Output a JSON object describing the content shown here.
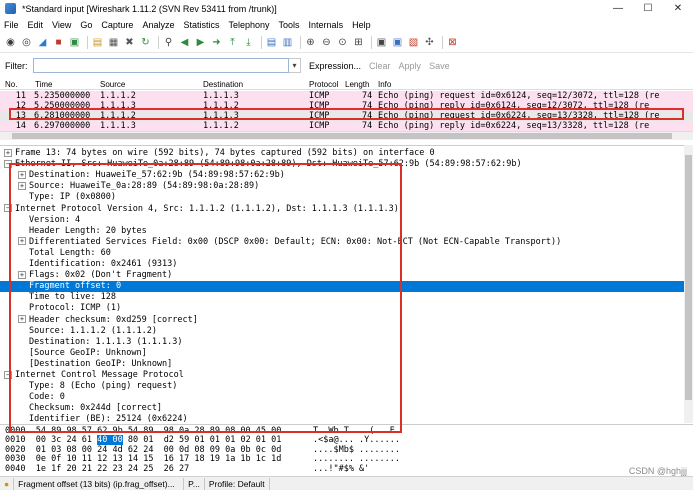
{
  "window": {
    "title": "*Standard input [Wireshark 1.11.2 (SVN Rev 53411 from /trunk)]",
    "minimize": "—",
    "maximize": "☐",
    "close": "✕"
  },
  "menu": [
    "File",
    "Edit",
    "View",
    "Go",
    "Capture",
    "Analyze",
    "Statistics",
    "Telephony",
    "Tools",
    "Internals",
    "Help"
  ],
  "toolbar": {
    "icons": [
      {
        "name": "interfaces-icon",
        "glyph": "◉",
        "color": "#3a3a3a"
      },
      {
        "name": "options-icon",
        "glyph": "◎",
        "color": "#3a3a3a"
      },
      {
        "name": "start-capture-icon",
        "glyph": "◢",
        "color": "#2a7ad2"
      },
      {
        "name": "stop-capture-icon",
        "glyph": "■",
        "color": "#c0392b"
      },
      {
        "name": "restart-capture-icon",
        "glyph": "▣",
        "color": "#2e8b3d"
      },
      {
        "sep": true
      },
      {
        "name": "open-file-icon",
        "glyph": "▤",
        "color": "#c8961e"
      },
      {
        "name": "save-file-icon",
        "glyph": "▦",
        "color": "#555"
      },
      {
        "name": "close-file-icon",
        "glyph": "✖",
        "color": "#555"
      },
      {
        "name": "reload-icon",
        "glyph": "↻",
        "color": "#2e8b3d"
      },
      {
        "sep": true
      },
      {
        "name": "find-packet-icon",
        "glyph": "⚲",
        "color": "#444"
      },
      {
        "name": "go-back-icon",
        "glyph": "◀",
        "color": "#2e8b3d"
      },
      {
        "name": "go-forward-icon",
        "glyph": "▶",
        "color": "#2e8b3d"
      },
      {
        "name": "go-to-packet-icon",
        "glyph": "➜",
        "color": "#2e8b3d"
      },
      {
        "name": "first-packet-icon",
        "glyph": "⤒",
        "color": "#2e8b3d"
      },
      {
        "name": "last-packet-icon",
        "glyph": "⤓",
        "color": "#2e8b3d"
      },
      {
        "sep": true
      },
      {
        "name": "colorize-icon",
        "glyph": "▤",
        "color": "#3a6fc2"
      },
      {
        "name": "autoscroll-icon",
        "glyph": "▥",
        "color": "#3a6fc2"
      },
      {
        "sep": true
      },
      {
        "name": "zoom-in-icon",
        "glyph": "⊕",
        "color": "#444"
      },
      {
        "name": "zoom-out-icon",
        "glyph": "⊖",
        "color": "#444"
      },
      {
        "name": "zoom-normal-icon",
        "glyph": "⊙",
        "color": "#444"
      },
      {
        "name": "resize-columns-icon",
        "glyph": "⊞",
        "color": "#444"
      },
      {
        "sep": true
      },
      {
        "name": "capture-filters-icon",
        "glyph": "▣",
        "color": "#444"
      },
      {
        "name": "display-filters-icon",
        "glyph": "▣",
        "color": "#3a6fc2"
      },
      {
        "name": "coloring-rules-icon",
        "glyph": "▧",
        "color": "#c0392b"
      },
      {
        "name": "preferences-icon",
        "glyph": "✣",
        "color": "#555"
      },
      {
        "sep": true
      },
      {
        "name": "help-icon",
        "glyph": "⊠",
        "color": "#c0392b"
      }
    ]
  },
  "filter": {
    "label": "Filter:",
    "value": "",
    "dropdown": "▾",
    "expression": "Expression...",
    "clear": "Clear",
    "apply": "Apply",
    "save": "Save"
  },
  "packet_list": {
    "columns": [
      "No.",
      "Time",
      "Source",
      "Destination",
      "Protocol",
      "Length",
      "Info"
    ],
    "rows": [
      {
        "no": "11",
        "time": "5.235000000",
        "src": "1.1.1.2",
        "dst": "1.1.1.3",
        "proto": "ICMP",
        "len": "74",
        "info": "Echo (ping) request  id=0x6124, seq=12/3072, ttl=128 (re",
        "bg": "#fde0ef",
        "sel": false
      },
      {
        "no": "12",
        "time": "5.250000000",
        "src": "1.1.1.3",
        "dst": "1.1.1.2",
        "proto": "ICMP",
        "len": "74",
        "info": "Echo (ping) reply    id=0x6124, seq=12/3072, ttl=128 (re",
        "bg": "#fde0ef",
        "sel": false
      },
      {
        "no": "13",
        "time": "6.281000000",
        "src": "1.1.1.2",
        "dst": "1.1.1.3",
        "proto": "ICMP",
        "len": "74",
        "info": "Echo (ping) request  id=0x6224, seq=13/3328, ttl=128 (re",
        "bg": "#e8e8e8",
        "sel": true
      },
      {
        "no": "14",
        "time": "6.297000000",
        "src": "1.1.1.3",
        "dst": "1.1.1.2",
        "proto": "ICMP",
        "len": "74",
        "info": "Echo (ping) reply    id=0x6224, seq=13/3328, ttl=128 (re",
        "bg": "#fde0ef",
        "sel": false
      }
    ]
  },
  "details": [
    {
      "indent": 0,
      "exp": "+",
      "text": "Frame 13: 74 bytes on wire (592 bits), 74 bytes captured (592 bits) on interface 0"
    },
    {
      "indent": 0,
      "exp": "-",
      "text": "Ethernet II, Src: HuaweiTe_0a:28:89 (54:89:98:0a:28:89), Dst: HuaweiTe_57:62:9b (54:89:98:57:62:9b)"
    },
    {
      "indent": 1,
      "exp": "+",
      "text": "Destination: HuaweiTe_57:62:9b (54:89:98:57:62:9b)"
    },
    {
      "indent": 1,
      "exp": "+",
      "text": "Source: HuaweiTe_0a:28:89 (54:89:98:0a:28:89)"
    },
    {
      "indent": 1,
      "exp": "",
      "text": "Type: IP (0x0800)"
    },
    {
      "indent": 0,
      "exp": "-",
      "text": "Internet Protocol Version 4, Src: 1.1.1.2 (1.1.1.2), Dst: 1.1.1.3 (1.1.1.3)"
    },
    {
      "indent": 1,
      "exp": "",
      "text": "Version: 4"
    },
    {
      "indent": 1,
      "exp": "",
      "text": "Header Length: 20 bytes"
    },
    {
      "indent": 1,
      "exp": "+",
      "text": "Differentiated Services Field: 0x00 (DSCP 0x00: Default; ECN: 0x00: Not-ECT (Not ECN-Capable Transport))"
    },
    {
      "indent": 1,
      "exp": "",
      "text": "Total Length: 60"
    },
    {
      "indent": 1,
      "exp": "",
      "text": "Identification: 0x2461 (9313)"
    },
    {
      "indent": 1,
      "exp": "+",
      "text": "Flags: 0x02 (Don't Fragment)"
    },
    {
      "indent": 1,
      "exp": "",
      "text": "Fragment offset: 0",
      "sel": true
    },
    {
      "indent": 1,
      "exp": "",
      "text": "Time to live: 128"
    },
    {
      "indent": 1,
      "exp": "",
      "text": "Protocol: ICMP (1)"
    },
    {
      "indent": 1,
      "exp": "+",
      "text": "Header checksum: 0xd259 [correct]"
    },
    {
      "indent": 1,
      "exp": "",
      "text": "Source: 1.1.1.2 (1.1.1.2)"
    },
    {
      "indent": 1,
      "exp": "",
      "text": "Destination: 1.1.1.3 (1.1.1.3)"
    },
    {
      "indent": 1,
      "exp": "",
      "text": "[Source GeoIP: Unknown]"
    },
    {
      "indent": 1,
      "exp": "",
      "text": "[Destination GeoIP: Unknown]"
    },
    {
      "indent": 0,
      "exp": "-",
      "text": "Internet Control Message Protocol"
    },
    {
      "indent": 1,
      "exp": "",
      "text": "Type: 8 (Echo (ping) request)"
    },
    {
      "indent": 1,
      "exp": "",
      "text": "Code: 0"
    },
    {
      "indent": 1,
      "exp": "",
      "text": "Checksum: 0x244d [correct]"
    },
    {
      "indent": 1,
      "exp": "",
      "text": "Identifier (BE): 25124 (0x6224)"
    }
  ],
  "bytes": [
    {
      "off": "0000",
      "pre": "54 89 98 57 62 9b 54 89  98 0a 28 89 08 00 45 00",
      "hl": "",
      "post": "",
      "ascii": "T..Wb.T. ..(...E."
    },
    {
      "off": "0010",
      "pre": "00 3c 24 61 ",
      "hl": "40 00",
      "post": " 80 01  d2 59 01 01 01 02 01 01",
      "ascii": ".<$a@... .Y......"
    },
    {
      "off": "0020",
      "pre": "01 03 08 00 24 4d 62 24  00 0d 08 09 0a 0b 0c 0d",
      "hl": "",
      "post": "",
      "ascii": "....$Mb$ ........"
    },
    {
      "off": "0030",
      "pre": "0e 0f 10 11 12 13 14 15  16 17 18 19 1a 1b 1c 1d",
      "hl": "",
      "post": "",
      "ascii": "........ ........"
    },
    {
      "off": "0040",
      "pre": "1e 1f 20 21 22 23 24 25  26 27",
      "hl": "",
      "post": "",
      "ascii": "...!\"#$% &'"
    }
  ],
  "status": {
    "field": "Fragment offset (13 bits) (ip.frag_offset)...",
    "packets": "P...",
    "profile": "Profile: Default"
  },
  "watermark": "CSDN @hghjjj",
  "colors": {
    "selection": "#0078d7",
    "annotation": "#d9302a",
    "icmp_row": "#fde0ef"
  }
}
